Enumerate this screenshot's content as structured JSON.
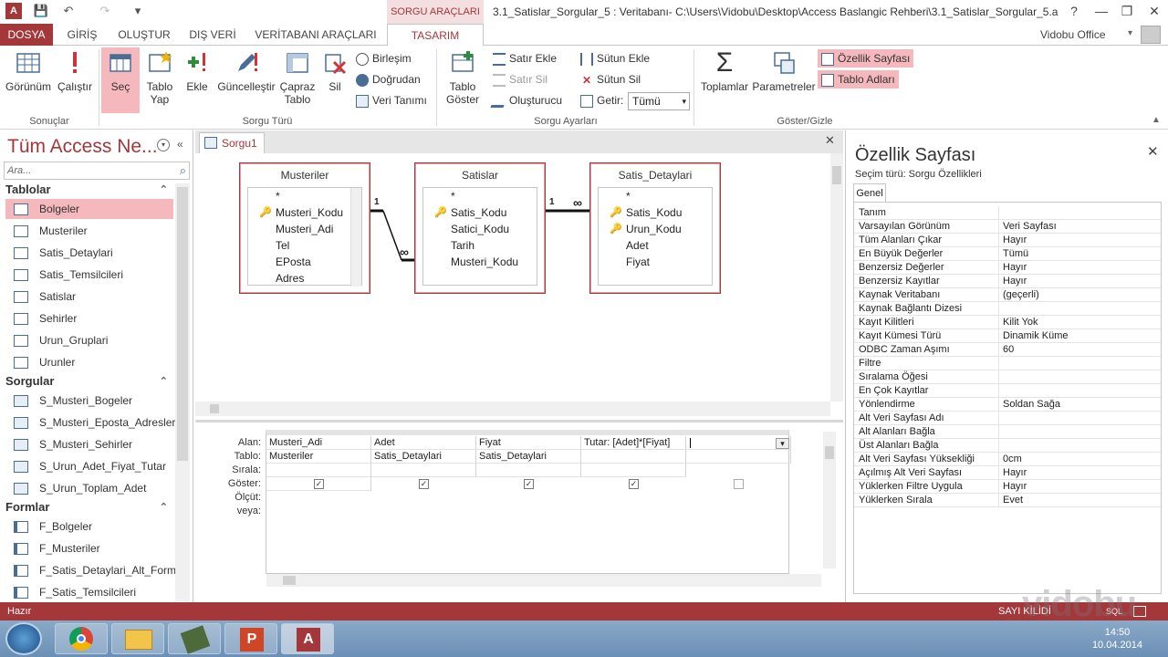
{
  "titlebar": {
    "app_icon": "A",
    "context_tab": "SORGU ARAÇLARI",
    "title": "3.1_Satislar_Sorgular_5 : Veritabanı- C:\\Users\\Vidobu\\Desktop\\Access Baslangic Rehberi\\3.1_Satislar_Sorgular_5.acc...",
    "help": "?",
    "minimize": "—",
    "restore": "❐",
    "close": "✕"
  },
  "tabs": [
    "DOSYA",
    "GİRİŞ",
    "OLUŞTUR",
    "DIŞ VERİ",
    "VERİTABANI ARAÇLARI",
    "TASARIM"
  ],
  "user": "Vidobu Office",
  "ribbon": {
    "groups": [
      "Sonuçlar",
      "Sorgu Türü",
      "Sorgu Ayarları",
      "Göster/Gizle"
    ],
    "gorunum": "Görünüm",
    "calistir": "Çalıştır",
    "sec": "Seç",
    "tablo_yap": "Tablo Yap",
    "ekle": "Ekle",
    "guncellestir": "Güncelleştir",
    "capraz_tablo": "Çapraz Tablo",
    "sil": "Sil",
    "birlesim": "Birleşim",
    "dogrudan": "Doğrudan",
    "veri_tanimi": "Veri Tanımı",
    "tablo_goster": "Tablo Göster",
    "satir_ekle": "Satır Ekle",
    "satir_sil": "Satır Sil",
    "olusturucu": "Oluşturucu",
    "sutun_ekle": "Sütun Ekle",
    "sutun_sil": "Sütun Sil",
    "getir_label": "Getir:",
    "getir_value": "Tümü",
    "toplamlar": "Toplamlar",
    "parametreler": "Parametreler",
    "ozellik_sayfasi": "Özellik Sayfası",
    "tablo_adlari": "Tablo Adları"
  },
  "nav": {
    "title": "Tüm Access Ne...",
    "search_placeholder": "Ara...",
    "sections": [
      {
        "label": "Tablolar",
        "items": [
          "Bolgeler",
          "Musteriler",
          "Satis_Detaylari",
          "Satis_Temsilcileri",
          "Satislar",
          "Sehirler",
          "Urun_Gruplari",
          "Urunler"
        ]
      },
      {
        "label": "Sorgular",
        "items": [
          "S_Musteri_Bogeler",
          "S_Musteri_Eposta_Adresleri",
          "S_Musteri_Sehirler",
          "S_Urun_Adet_Fiyat_Tutar",
          "S_Urun_Toplam_Adet"
        ]
      },
      {
        "label": "Formlar",
        "items": [
          "F_Bolgeler",
          "F_Musteriler",
          "F_Satis_Detaylari_Alt_Form",
          "F_Satis_Temsilcileri"
        ]
      }
    ]
  },
  "doc_tab": "Sorgu1",
  "query_tables": [
    {
      "name": "Musteriler",
      "fields": [
        "*",
        "Musteri_Kodu",
        "Musteri_Adi",
        "Tel",
        "EPosta",
        "Adres"
      ]
    },
    {
      "name": "Satislar",
      "fields": [
        "*",
        "Satis_Kodu",
        "Satici_Kodu",
        "Tarih",
        "Musteri_Kodu"
      ]
    },
    {
      "name": "Satis_Detaylari",
      "fields": [
        "*",
        "Satis_Kodu",
        "Urun_Kodu",
        "Adet",
        "Fiyat"
      ]
    }
  ],
  "relations": {
    "one": "1",
    "many": "∞"
  },
  "grid": {
    "row_labels": [
      "Alan:",
      "Tablo:",
      "Sırala:",
      "Göster:",
      "Ölçüt:",
      "veya:"
    ],
    "columns": [
      {
        "alan": "Musteri_Adi",
        "tablo": "Musteriler",
        "goster": true
      },
      {
        "alan": "Adet",
        "tablo": "Satis_Detaylari",
        "goster": true
      },
      {
        "alan": "Fiyat",
        "tablo": "Satis_Detaylari",
        "goster": true
      },
      {
        "alan": "Tutar: [Adet]*[Fiyat]",
        "tablo": "",
        "goster": true
      },
      {
        "alan": "",
        "tablo": "",
        "goster": false
      }
    ]
  },
  "props": {
    "title": "Özellik Sayfası",
    "selection": "Seçim türü:  Sorgu Özellikleri",
    "tab": "Genel",
    "rows": [
      [
        "Tanım",
        ""
      ],
      [
        "Varsayılan Görünüm",
        "Veri Sayfası"
      ],
      [
        "Tüm Alanları Çıkar",
        "Hayır"
      ],
      [
        "En Büyük Değerler",
        "Tümü"
      ],
      [
        "Benzersiz Değerler",
        "Hayır"
      ],
      [
        "Benzersiz Kayıtlar",
        "Hayır"
      ],
      [
        "Kaynak Veritabanı",
        "(geçerli)"
      ],
      [
        "Kaynak Bağlantı Dizesi",
        ""
      ],
      [
        "Kayıt Kilitleri",
        "Kilit Yok"
      ],
      [
        "Kayıt Kümesi Türü",
        "Dinamik Küme"
      ],
      [
        "ODBC Zaman Aşımı",
        "60"
      ],
      [
        "Filtre",
        ""
      ],
      [
        "Sıralama Öğesi",
        ""
      ],
      [
        "En Çok Kayıtlar",
        ""
      ],
      [
        "Yönlendirme",
        "Soldan Sağa"
      ],
      [
        "Alt Veri Sayfası Adı",
        ""
      ],
      [
        "Alt Alanları Bağla",
        ""
      ],
      [
        "Üst Alanları Bağla",
        ""
      ],
      [
        "Alt Veri Sayfası Yüksekliği",
        "0cm"
      ],
      [
        "Açılmış Alt Veri Sayfası",
        "Hayır"
      ],
      [
        "Yüklerken Filtre Uygula",
        "Hayır"
      ],
      [
        "Yüklerken Sırala",
        "Evet"
      ]
    ]
  },
  "status": {
    "left": "Hazır",
    "right": "SAYI KİLİDİ",
    "sql": "SQL"
  },
  "taskbar": {
    "time": "14:50",
    "date": "10.04.2014"
  },
  "watermark": "vidobu",
  "colors": {
    "accent": "#a4373a",
    "selected": "#f5b8bd"
  }
}
